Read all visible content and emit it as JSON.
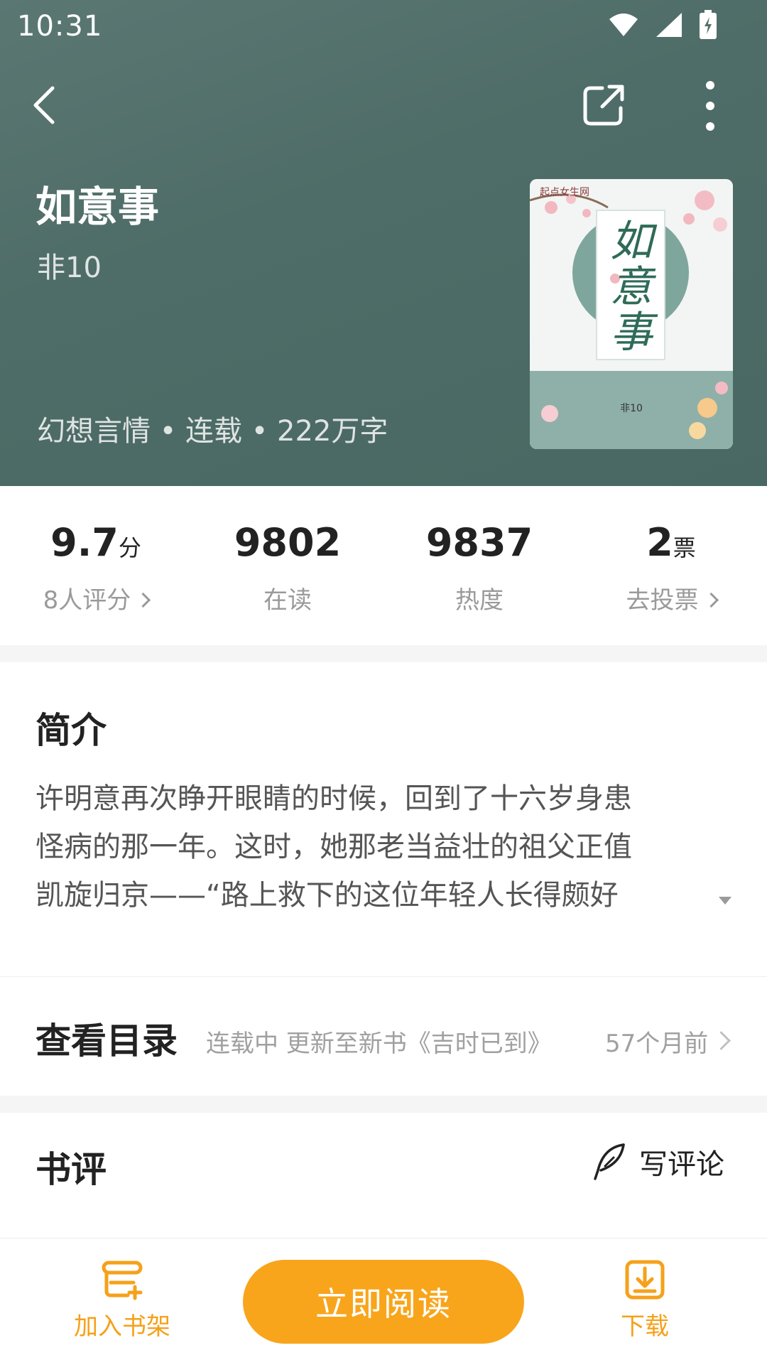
{
  "status_bar": {
    "time": "10:31"
  },
  "book": {
    "title": "如意事",
    "author": "非10",
    "meta": "幻想言情 • 连载 • 222万字",
    "cover_title": "如意事",
    "cover_author": "非10",
    "cover_logo": "起点女生网"
  },
  "stats": [
    {
      "value": "9.7",
      "unit": "分",
      "label": "8人评分"
    },
    {
      "value": "9802",
      "unit": "",
      "label": "在读"
    },
    {
      "value": "9837",
      "unit": "",
      "label": "热度"
    },
    {
      "value": "2",
      "unit": "票",
      "label": "去投票"
    }
  ],
  "intro": {
    "title": "简介",
    "lines": [
      "许明意再次睁开眼睛的时候，回到了十六岁身患",
      "怪病的那一年。这时，她那老当益壮的祖父正值",
      "凯旋归京——“路上救下的这位年轻人长得颇好"
    ]
  },
  "toc": {
    "title": "查看目录",
    "update": "连载中 更新至新书《吉时已到》",
    "time": "57个月前"
  },
  "review": {
    "title": "书评",
    "write_label": "写评论"
  },
  "bottom_bar": {
    "bookshelf_label": "加入书架",
    "read_label": "立即阅读",
    "download_label": "下载"
  },
  "colors": {
    "header_bg": "#4f6d68",
    "accent": "#f8a51b",
    "muted_text": "#9a9a9a"
  },
  "icons": {
    "back": "back-arrow-icon",
    "share": "share-icon",
    "more": "more-vertical-icon",
    "wifi": "wifi-icon",
    "signal": "signal-icon",
    "battery": "battery-icon",
    "quill": "quill-icon",
    "bookshelf": "bookshelf-icon",
    "download": "download-icon"
  }
}
